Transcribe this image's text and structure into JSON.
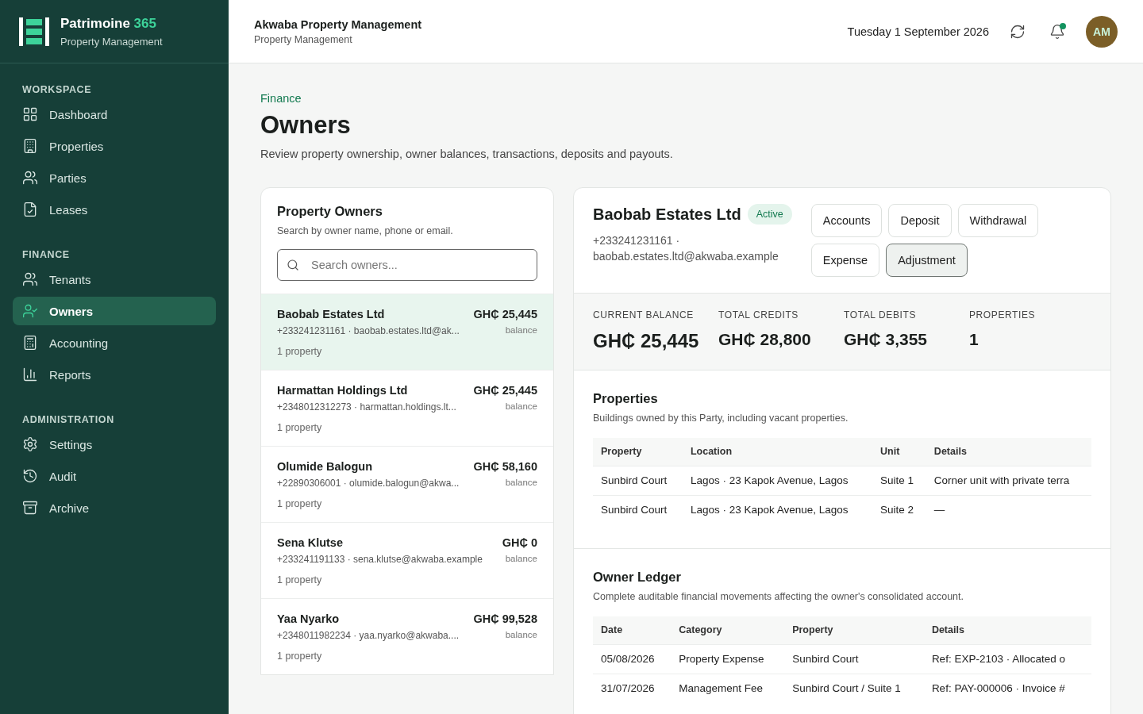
{
  "brand": {
    "name": "Patrimoine",
    "accent": "365",
    "subtitle": "Property Management"
  },
  "sidebar": {
    "sections": [
      {
        "title": "WORKSPACE",
        "items": [
          {
            "label": "Dashboard",
            "selected": false
          },
          {
            "label": "Properties",
            "selected": false
          },
          {
            "label": "Parties",
            "selected": false
          },
          {
            "label": "Leases",
            "selected": false
          }
        ]
      },
      {
        "title": "FINANCE",
        "items": [
          {
            "label": "Tenants",
            "selected": false
          },
          {
            "label": "Owners",
            "selected": true
          },
          {
            "label": "Accounting",
            "selected": false
          },
          {
            "label": "Reports",
            "selected": false
          }
        ]
      },
      {
        "title": "ADMINISTRATION",
        "items": [
          {
            "label": "Settings",
            "selected": false
          },
          {
            "label": "Audit",
            "selected": false
          },
          {
            "label": "Archive",
            "selected": false
          }
        ]
      }
    ]
  },
  "header": {
    "org": "Akwaba Property Management",
    "org_subtitle": "Property Management",
    "date": "Tuesday 1 September 2026",
    "notification_dot": true,
    "avatar": "AM"
  },
  "page": {
    "breadcrumb": "Finance",
    "title": "Owners",
    "description": "Review property ownership, owner balances, transactions, deposits and payouts."
  },
  "owners_panel": {
    "title": "Property Owners",
    "subtitle": "Search by owner name, phone or email.",
    "search": {
      "placeholder": "Search owners..."
    },
    "owners": [
      {
        "name": "Baobab Estates Ltd",
        "contact": "+233241231161 · baobab.estates.ltd@ak...",
        "amount": "GH₵ 25,445",
        "amount_label": "balance",
        "properties": "1 property",
        "selected": true
      },
      {
        "name": "Harmattan Holdings Ltd",
        "contact": "+2348012312273 · harmattan.holdings.lt...",
        "amount": "GH₵ 25,445",
        "amount_label": "balance",
        "properties": "1 property",
        "selected": false
      },
      {
        "name": "Olumide Balogun",
        "contact": "+22890306001 · olumide.balogun@akwa...",
        "amount": "GH₵ 58,160",
        "amount_label": "balance",
        "properties": "1 property",
        "selected": false
      },
      {
        "name": "Sena Klutse",
        "contact": "+233241191133 · sena.klutse@akwaba.example",
        "amount": "GH₵ 0",
        "amount_label": "balance",
        "properties": "1 property",
        "selected": false
      },
      {
        "name": "Yaa Nyarko",
        "contact": "+2348011982234 · yaa.nyarko@akwaba....",
        "amount": "GH₵ 99,528",
        "amount_label": "balance",
        "properties": "1 property",
        "selected": false
      }
    ]
  },
  "detail": {
    "name": "Baobab Estates Ltd",
    "status": "Active",
    "contact": "+233241231161 · baobab.estates.ltd@akwaba.example",
    "actions": [
      {
        "label": "Accounts",
        "selected": false
      },
      {
        "label": "Deposit",
        "selected": false
      },
      {
        "label": "Withdrawal",
        "selected": false
      },
      {
        "label": "Expense",
        "selected": false
      },
      {
        "label": "Adjustment",
        "selected": true
      }
    ],
    "stats": [
      {
        "label": "CURRENT BALANCE",
        "value": "GH₵ 25,445"
      },
      {
        "label": "TOTAL CREDITS",
        "value": "GH₵ 28,800"
      },
      {
        "label": "TOTAL DEBITS",
        "value": "GH₵ 3,355"
      },
      {
        "label": "PROPERTIES",
        "value": "1"
      }
    ],
    "properties": {
      "title": "Properties",
      "subtitle": "Buildings owned by this Party, including vacant properties.",
      "columns": [
        "Property",
        "Location",
        "Unit",
        "Details"
      ],
      "rows": [
        [
          "Sunbird Court",
          "Lagos · 23 Kapok Avenue, Lagos",
          "Suite 1",
          "Corner unit with private terra"
        ],
        [
          "Sunbird Court",
          "Lagos · 23 Kapok Avenue, Lagos",
          "Suite 2",
          "—"
        ]
      ]
    },
    "ledger": {
      "title": "Owner Ledger",
      "subtitle": "Complete auditable financial movements affecting the owner's consolidated account.",
      "columns": [
        "Date",
        "Category",
        "Property",
        "Details"
      ],
      "rows": [
        [
          "05/08/2026",
          "Property Expense",
          "Sunbird Court",
          "Ref: EXP-2103 · Allocated o"
        ],
        [
          "31/07/2026",
          "Management Fee",
          "Sunbird Court / Suite 1",
          "Ref: PAY-000006 · Invoice #"
        ]
      ]
    }
  }
}
